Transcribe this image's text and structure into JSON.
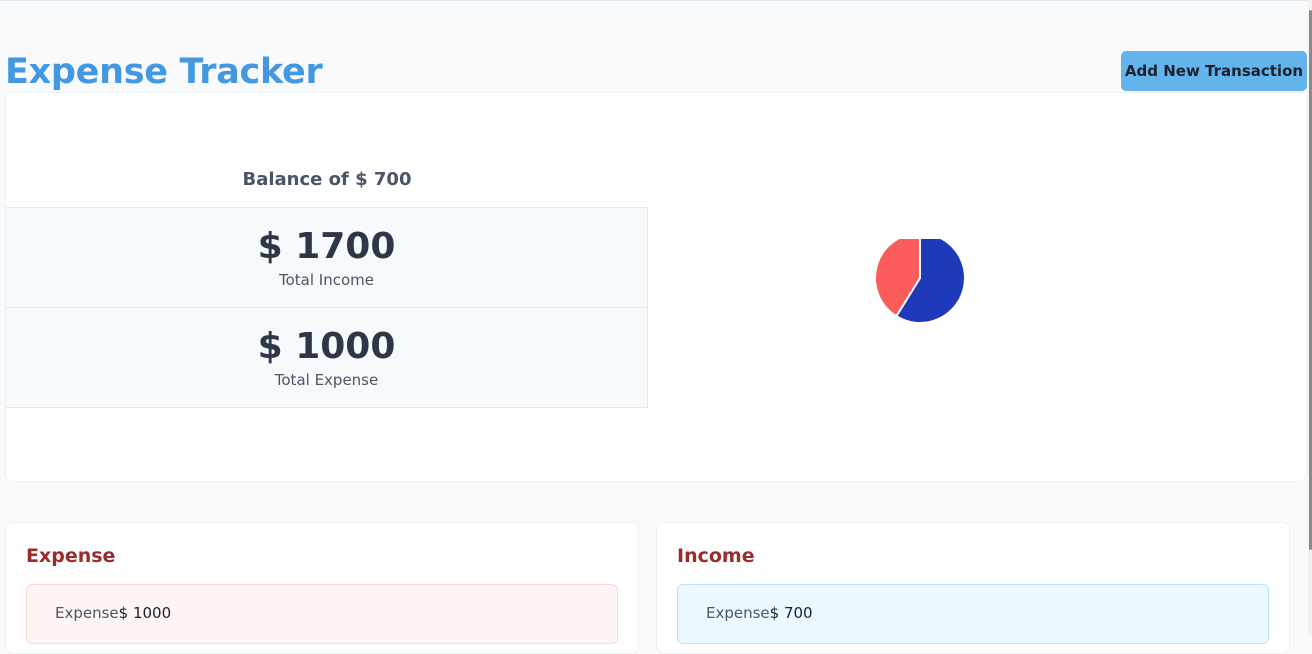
{
  "header": {
    "title": "Expense Tracker",
    "add_button_label": "Add New Transaction"
  },
  "summary": {
    "balance_text": "Balance of $ 700",
    "income_value": "$ 1700",
    "income_label": "Total Income",
    "expense_value": "$ 1000",
    "expense_label": "Total Expense"
  },
  "chart_data": {
    "type": "pie",
    "slices": [
      {
        "value": 1000,
        "color": "#1e3ab8"
      },
      {
        "value": 700,
        "color": "#fc5c5c"
      }
    ]
  },
  "lists": {
    "expense": {
      "title": "Expense",
      "items": [
        {
          "label": "Expense",
          "amount": "$ 1000"
        }
      ]
    },
    "income": {
      "title": "Income",
      "items": [
        {
          "label": "Expense",
          "amount": "$ 700"
        }
      ]
    }
  },
  "colors": {
    "title": "#4299e1",
    "button_bg": "#63b3ed",
    "list_title": "#9b2c2c",
    "expense_item_bg": "#fff5f5",
    "income_item_bg": "#ebf8ff"
  }
}
